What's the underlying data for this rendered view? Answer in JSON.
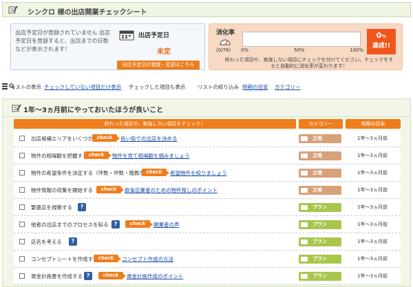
{
  "header": {
    "title": "シンクロ 様の出店開業チェックシート"
  },
  "opening_info": {
    "message": "出店予定日が登録されていません 出店予定日を登録すると、出店までの日数などが表示されます！",
    "date_label": "出店予定日",
    "date_value": "未定",
    "date_button": "出店予定日の登録・変更はこちら"
  },
  "progress": {
    "label": "消化率",
    "count": "(0/76)",
    "percent": 0,
    "tick_0": "0%",
    "tick_50": "50%",
    "tick_100": "100%",
    "badge_value": "0",
    "badge_unit": "%",
    "badge_text": "達成!!",
    "note": "終わった項目や、実施しない項目にチェックを付けてください。チェックをすると自動的に消化率が変わります！"
  },
  "filters": {
    "list_display_label": "リストの表示",
    "unchecked_only": "チェックしていない項目だけ表示",
    "show_checked": "チェックした項目も表示",
    "narrow_label": "リストの絞り込み",
    "by_time": "時期の目安",
    "by_category": "カテゴリー"
  },
  "section": {
    "title": "1年～3ヵ月前にやっておいたほうが良いこと",
    "col_items": "終わった項目や、実施しない項目をチェック！",
    "col_category": "カテゴリー",
    "col_time": "時期の目安",
    "check_badge": "check",
    "help_badge": "?",
    "rows": [
      {
        "label": "出店候補エリアをいくつか選定する",
        "check": "check",
        "link": "良い街での出店を決める",
        "category": "立地",
        "time": "1年～3ヵ月前"
      },
      {
        "label": "物件の相場観を把握する",
        "check": "check",
        "link": "物件を見て相場観を掴みましょう",
        "category": "立地",
        "time": "1年～3ヵ月前"
      },
      {
        "label": "物件の希望条件を決定する（坪数・坪数・階数など）",
        "check": "check",
        "link": "希望物件を絞りましょう",
        "category": "立地",
        "time": "1年～3ヵ月前"
      },
      {
        "label": "物件情報の収集を開始する",
        "check": "check",
        "link": "飲食店業者のための物件探しのポイント",
        "category": "立地",
        "time": "1年～3ヵ月前"
      },
      {
        "label": "繁盛店を視察する",
        "help": "?",
        "category": "プラン",
        "time": "1年～3ヵ月前"
      },
      {
        "label": "他者の出店までのプロセスを知る",
        "help": "?",
        "check": "check",
        "link": "開業者の声",
        "category": "プラン",
        "time": "1年～3ヵ月前"
      },
      {
        "label": "店名を考える",
        "help": "?",
        "category": "プラン",
        "time": "1年～3ヵ月前"
      },
      {
        "label": "コンセプトシートを作成する",
        "check": "check",
        "link": "コンセプト作成の方法",
        "category": "プラン",
        "time": "1年～3ヵ月前"
      },
      {
        "label": "資金計画書を作成する",
        "help": "?",
        "check": "check",
        "link": "資金計画作成のポイント",
        "category": "プラン",
        "time": "1年～3ヵ月前"
      }
    ]
  },
  "colors": {
    "orange": "#ef7d1b",
    "location": "#d7a179",
    "plan": "#a9c64c",
    "link": "#1a4aa8"
  },
  "icons": {
    "pen": "pen-icon",
    "calendar": "calendar-icon",
    "gauge": "gauge-icon",
    "search": "search-icon",
    "list": "list-icon",
    "location": "store-icon",
    "plan": "document-icon"
  }
}
